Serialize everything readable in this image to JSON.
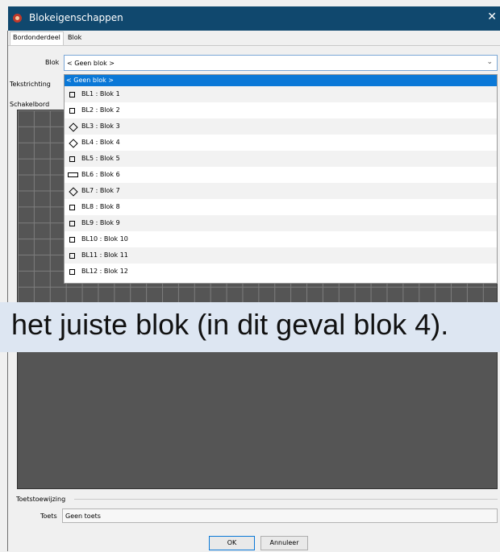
{
  "window": {
    "title": "Blokeigenschappen",
    "close_glyph": "✕",
    "colors": {
      "titlebar": "#10486e",
      "selection": "#0a78d7"
    }
  },
  "tabs": [
    "Bordonderdeel",
    "Blok"
  ],
  "form": {
    "blok_label": "Blok",
    "blok_value": "< Geen blok >",
    "tekstrichting_label": "Tekstrichting",
    "schakelbord_label": "Schakelbord",
    "dropdown_items": [
      {
        "label": "< Geen blok >",
        "icon": "none",
        "selected": true
      },
      {
        "label": "BL1 : Blok 1",
        "icon": "square-icon"
      },
      {
        "label": "BL2 : Blok 2",
        "icon": "square-icon"
      },
      {
        "label": "BL3 : Blok 3",
        "icon": "diamond-icon"
      },
      {
        "label": "BL4 : Blok 4",
        "icon": "diamond-icon"
      },
      {
        "label": "BL5 : Blok 5",
        "icon": "square-icon"
      },
      {
        "label": "BL6 : Blok 6",
        "icon": "rectangle-icon"
      },
      {
        "label": "BL7 : Blok 7",
        "icon": "diamond-icon"
      },
      {
        "label": "BL8 : Blok 8",
        "icon": "square-icon"
      },
      {
        "label": "BL9 : Blok 9",
        "icon": "square-icon"
      },
      {
        "label": "BL10 : Blok 10",
        "icon": "square-icon"
      },
      {
        "label": "BL11 : Blok 11",
        "icon": "square-icon"
      },
      {
        "label": "BL12 : Blok 12",
        "icon": "square-icon"
      }
    ],
    "toetstoewijzing_label": "Toetstoewijzing",
    "toets_label": "Toets",
    "toets_value": "Geen toets"
  },
  "overlay_caption": "het juiste blok (in dit geval blok 4).",
  "buttons": {
    "ok": "OK",
    "cancel": "Annuleer"
  }
}
